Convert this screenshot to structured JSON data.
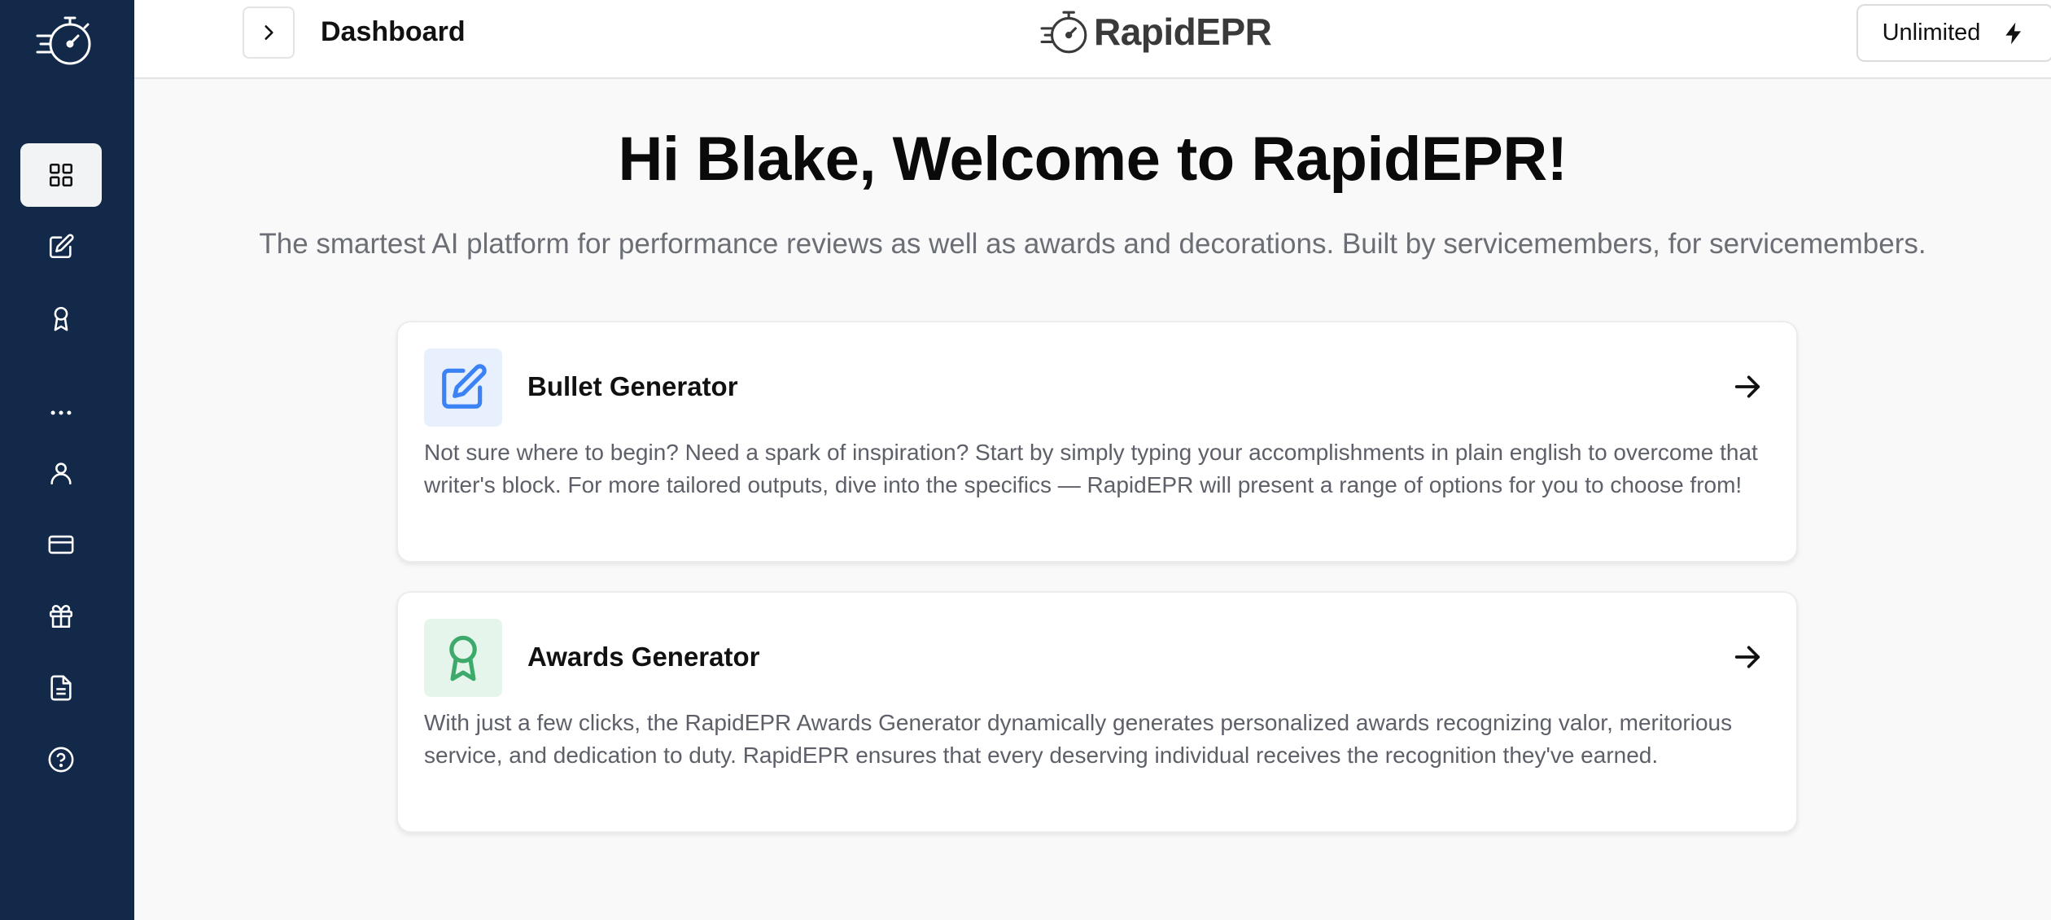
{
  "header": {
    "page_title": "Dashboard",
    "brand": "RapidEPR",
    "plan_label": "Unlimited"
  },
  "sidebar": {
    "items": [
      {
        "icon": "dashboard-grid-icon",
        "active": true
      },
      {
        "icon": "edit-icon",
        "active": false
      },
      {
        "icon": "award-icon",
        "active": false
      },
      {
        "icon": "more-dots-icon",
        "active": false
      },
      {
        "icon": "user-icon",
        "active": false
      },
      {
        "icon": "credit-card-icon",
        "active": false
      },
      {
        "icon": "gift-icon",
        "active": false
      },
      {
        "icon": "document-icon",
        "active": false
      },
      {
        "icon": "help-circle-icon",
        "active": false
      }
    ]
  },
  "hero": {
    "title": "Hi Blake, Welcome to RapidEPR!",
    "subtitle": "The smartest AI platform for performance reviews as well as awards and decorations. Built by servicemembers, for servicemembers."
  },
  "cards": [
    {
      "title": "Bullet Generator",
      "description": "Not sure where to begin? Need a spark of inspiration? Start by simply typing your accomplishments in plain english to overcome that writer's block. For more tailored outputs, dive into the specifics — RapidEPR will present a range of options for you to choose from!",
      "icon": "edit-icon",
      "accent": "#3b82f6",
      "icon_bg": "#e8f0fd"
    },
    {
      "title": "Awards Generator",
      "description": "With just a few clicks, the RapidEPR Awards Generator dynamically generates personalized awards recognizing valor, meritorious service, and dedication to duty. RapidEPR ensures that every deserving individual receives the recognition they've earned.",
      "icon": "award-icon",
      "accent": "#3daa6b",
      "icon_bg": "#e6f5ec"
    }
  ],
  "colors": {
    "sidebar_bg": "#12294a",
    "page_bg": "#f9f9f9"
  }
}
